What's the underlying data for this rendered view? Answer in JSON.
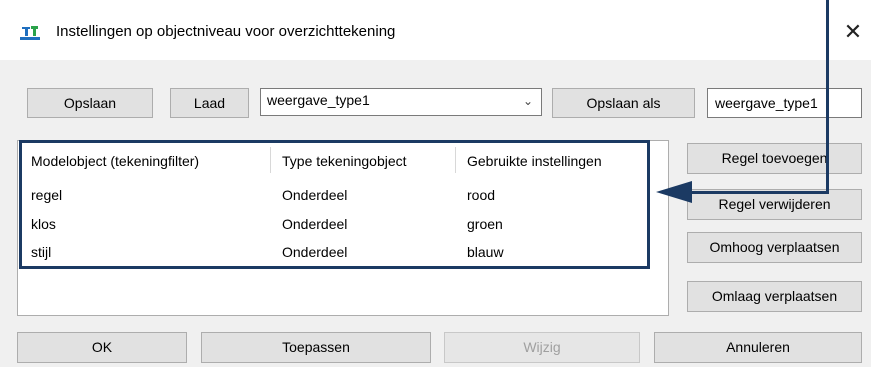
{
  "window": {
    "title": "Instellingen op objectniveau voor overzichttekening",
    "close_glyph": "✕"
  },
  "toolbar": {
    "save_label": "Opslaan",
    "load_label": "Laad",
    "preset_value": "weergave_type1",
    "save_as_label": "Opslaan als",
    "save_as_value": "weergave_type1"
  },
  "table": {
    "columns": [
      "Modelobject (tekeningfilter)",
      "Type tekeningobject",
      "Gebruikte instellingen"
    ],
    "rows": [
      [
        "regel",
        "Onderdeel",
        "rood"
      ],
      [
        "klos",
        "Onderdeel",
        "groen"
      ],
      [
        "stijl",
        "Onderdeel",
        "blauw"
      ]
    ]
  },
  "side_buttons": {
    "add_rule": "Regel toevoegen",
    "remove_rule": "Regel verwijderen",
    "move_up": "Omhoog verplaatsen",
    "move_down": "Omlaag verplaatsen"
  },
  "footer": {
    "ok": "OK",
    "apply": "Toepassen",
    "modify": "Wijzig",
    "cancel": "Annuleren"
  },
  "colors": {
    "annotation": "#1b3a63",
    "dialog_background": "#f0f0f0"
  }
}
